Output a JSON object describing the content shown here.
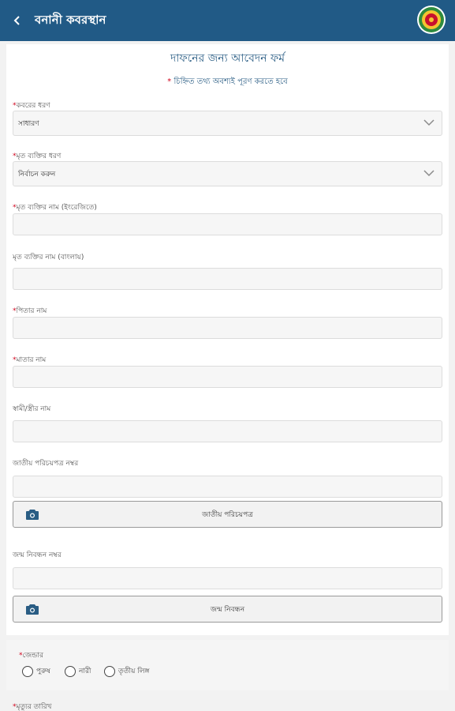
{
  "appbar": {
    "title": "বনানী কবরস্থান",
    "back_icon": "chevron-left-icon",
    "logo": "city-corporation-logo"
  },
  "form": {
    "title": "দাফনের জন্য আবেদন ফর্ম",
    "note_star": "*",
    "note": "চিহ্নিত তথ্য অবশ্যই পূরণ করতে হবে",
    "fields": {
      "grave_type": {
        "star": "*",
        "label": "কবরের ধরণ",
        "value": "সাধারণ"
      },
      "deceased_type": {
        "star": "*",
        "label": "মৃত ব্যক্তির ধরণ",
        "value": "নির্বাচন করুন"
      },
      "name_english": {
        "star": "*",
        "label": "মৃত ব্যক্তির নাম (ইংরেজিতে)",
        "value": ""
      },
      "name_bangla": {
        "label": "মৃত ব্যক্তির নাম (বাংলায়)",
        "value": ""
      },
      "father_name": {
        "star": "*",
        "label": "পিতার নাম",
        "value": ""
      },
      "mother_name": {
        "star": "*",
        "label": "মাতার নাম",
        "value": ""
      },
      "spouse_name": {
        "label": "স্বামী/স্ত্রীর নাম",
        "value": ""
      },
      "nid_number": {
        "label": "জাতীয় পরিচয়পত্র নম্বর",
        "value": ""
      },
      "nid_photo_button": "জাতীয় পরিচয়পত্র",
      "birth_reg_number": {
        "label": "জন্ম নিবন্ধন নম্বর",
        "value": ""
      },
      "birth_reg_photo_button": "জন্ম নিবন্ধন"
    },
    "gender": {
      "star": "*",
      "label": "জেন্ডার",
      "options": [
        "পুরুষ",
        "নারী",
        "তৃতীয় লিঙ্গ"
      ]
    },
    "date_of_death": {
      "star": "*",
      "label": "মৃত্যুর তারিখ"
    }
  },
  "colors": {
    "appbar": "#215a86",
    "required_star": "#d0021b",
    "title": "#2a5d84"
  }
}
